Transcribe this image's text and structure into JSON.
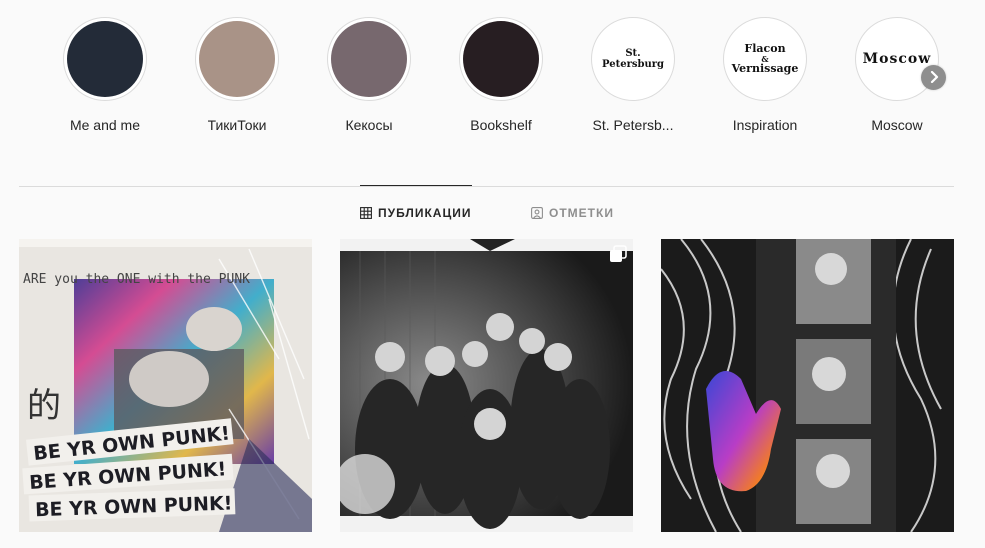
{
  "highlights": [
    {
      "label": "Me and me",
      "color": "#232b38",
      "cover_text": ""
    },
    {
      "label": "ТикиТоки",
      "color": "#a99387",
      "cover_text": ""
    },
    {
      "label": "Кекосы",
      "color": "#77686e",
      "cover_text": ""
    },
    {
      "label": "Bookshelf",
      "color": "#271e22",
      "cover_text": ""
    },
    {
      "label": "St. Petersb...",
      "color": "#ffffff",
      "cover_text": "St. Petersburg"
    },
    {
      "label": "Inspiration",
      "color": "#ffffff",
      "cover_text_1": "Flacon",
      "cover_text_2": "&",
      "cover_text_3": "Vernissage"
    },
    {
      "label": "Moscow",
      "color": "#ffffff",
      "cover_text": "Moscow"
    }
  ],
  "next_icon": "chevron-right-icon",
  "tabs": [
    {
      "label": "ПУБЛИКАЦИИ",
      "icon": "grid-icon",
      "active": true
    },
    {
      "label": "ОТМЕТКИ",
      "icon": "tag-person-icon",
      "active": false
    }
  ],
  "posts": [
    {
      "caption": "BE YR OWN PUNK!",
      "scribble": "ARE you the ONE with the PUNK",
      "kanji": "的",
      "multi": false
    },
    {
      "caption": "",
      "multi": true
    },
    {
      "caption": "",
      "multi": false
    }
  ]
}
